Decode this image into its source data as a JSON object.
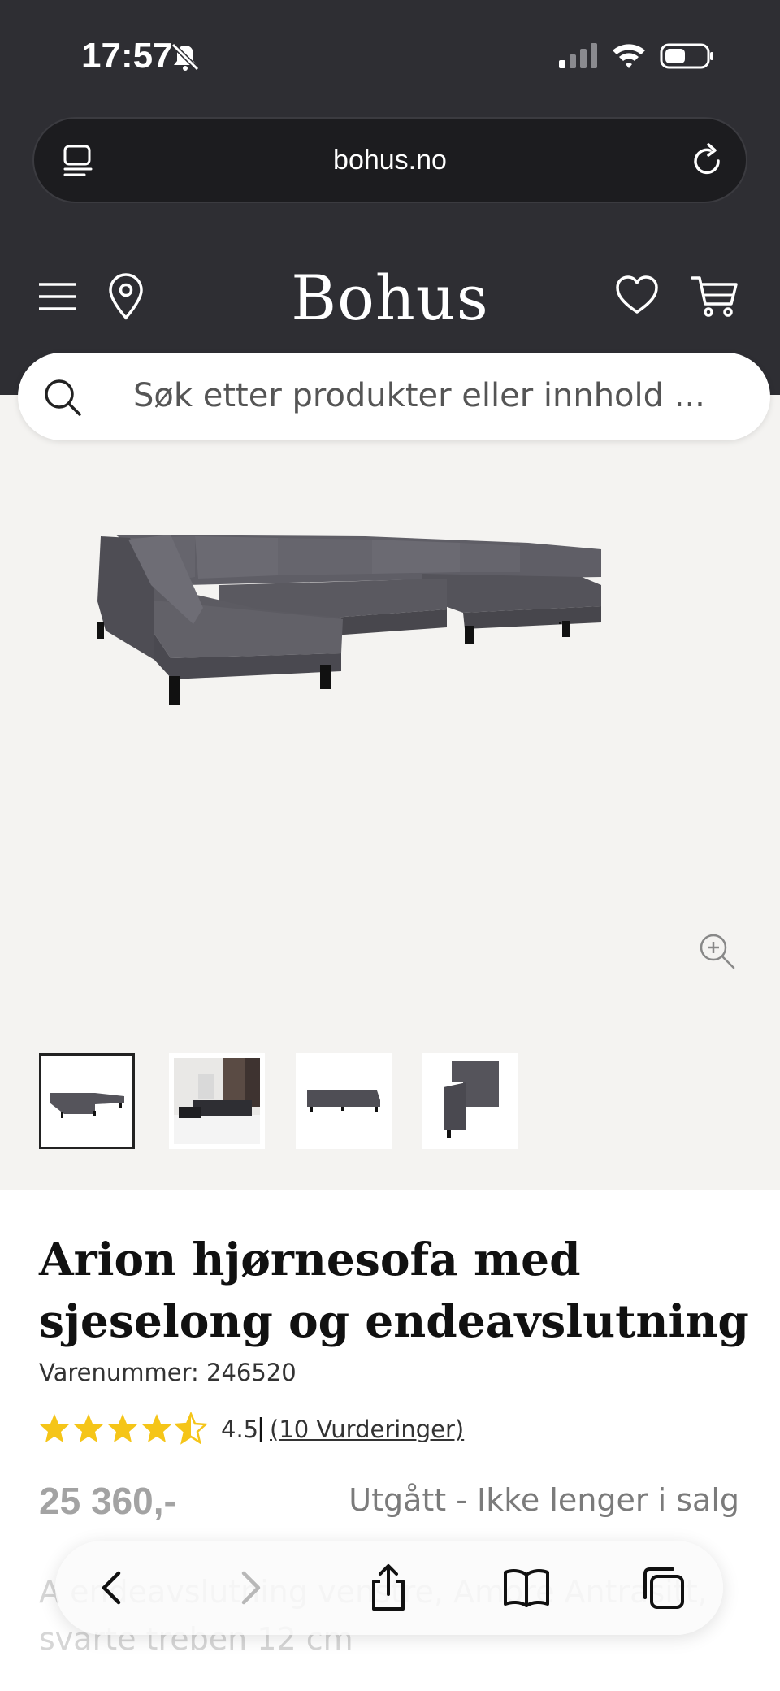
{
  "status_bar": {
    "time": "17:57",
    "icons": [
      "bell-slash-icon",
      "signal-icon",
      "wifi-icon",
      "battery-icon"
    ]
  },
  "browser": {
    "url": "bohus.no",
    "icons": [
      "reader-icon",
      "reload-icon"
    ]
  },
  "site_header": {
    "logo": "Bohus",
    "icons": [
      "menu-icon",
      "location-icon",
      "heart-icon",
      "cart-icon"
    ]
  },
  "search": {
    "placeholder": "Søk etter produkter eller innhold ..."
  },
  "gallery": {
    "thumbnail_count": 4,
    "selected_index": 0
  },
  "product": {
    "title": "Arion hjørnesofa med sjeselong og endeavslutning",
    "sku": "Varenummer: 246520",
    "rating": 4.5,
    "rating_text": "4.5",
    "rating_separator": "|",
    "reviews_link": "(10 Vurderinger)",
    "price": "25 360,-",
    "availability": "Utgått - Ikke lenger i salg",
    "description": "A endeavslutning venstre, Amore Antrasitt, svarte treben 12 cm"
  },
  "toolbar": {
    "buttons": [
      "back-icon",
      "forward-icon",
      "share-icon",
      "bookmarks-icon",
      "tabs-icon"
    ]
  },
  "colors": {
    "chrome": "#2e2e33",
    "gallery_bg": "#f4f3f1",
    "star": "#f5c518",
    "sofa": "#55545b"
  }
}
